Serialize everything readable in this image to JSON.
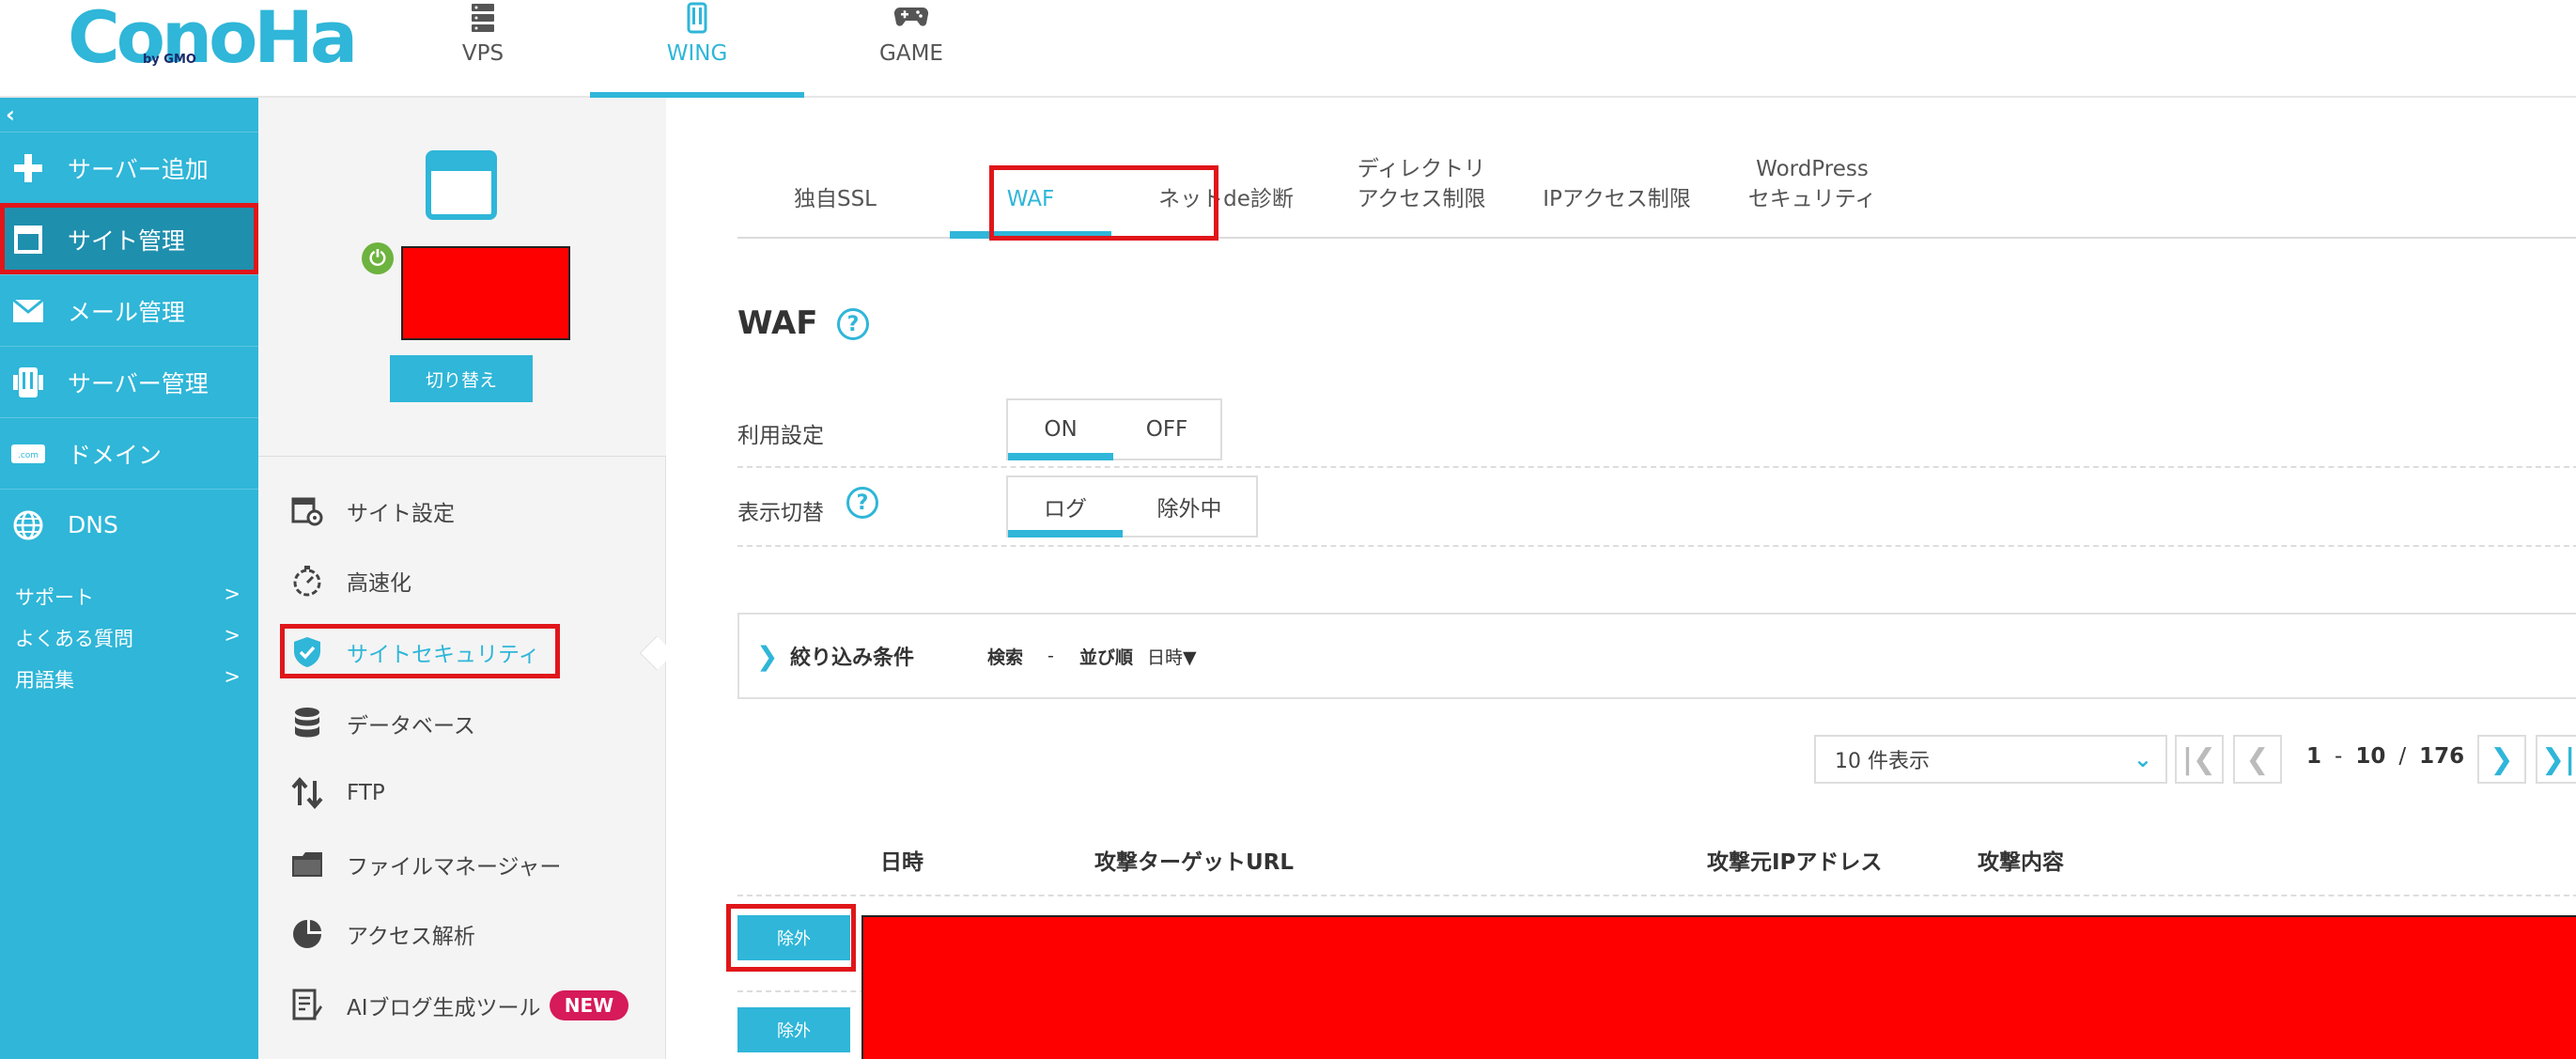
{
  "header": {
    "logo_text": "ConoHa",
    "logo_sub": "by GMO",
    "product_tabs": [
      {
        "label": "VPS",
        "icon": "server-icon",
        "active": false
      },
      {
        "label": "WING",
        "icon": "wing-icon",
        "active": true
      },
      {
        "label": "GAME",
        "icon": "gamepad-icon",
        "active": false
      }
    ]
  },
  "sidebar": {
    "collapse_label": "‹",
    "items": [
      {
        "label": "サーバー追加",
        "icon": "plus-icon",
        "active": false
      },
      {
        "label": "サイト管理",
        "icon": "window-icon",
        "active": true
      },
      {
        "label": "メール管理",
        "icon": "mail-icon",
        "active": false
      },
      {
        "label": "サーバー管理",
        "icon": "server-manage-icon",
        "active": false
      },
      {
        "label": "ドメイン",
        "icon": "domain-icon",
        "active": false
      },
      {
        "label": "DNS",
        "icon": "globe-icon",
        "active": false
      }
    ],
    "links": [
      {
        "label": "サポート",
        "arrow": ">"
      },
      {
        "label": "よくある質問",
        "arrow": ">"
      },
      {
        "label": "用語集",
        "arrow": ">"
      }
    ]
  },
  "site_panel": {
    "switch_label": "切り替え",
    "menu": [
      {
        "label": "サイト設定",
        "icon": "site-settings-icon",
        "active": false
      },
      {
        "label": "高速化",
        "icon": "stopwatch-icon",
        "active": false
      },
      {
        "label": "サイトセキュリティ",
        "icon": "shield-check-icon",
        "active": true
      },
      {
        "label": "データベース",
        "icon": "database-icon",
        "active": false
      },
      {
        "label": "FTP",
        "icon": "transfer-icon",
        "active": false
      },
      {
        "label": "ファイルマネージャー",
        "icon": "folder-icon",
        "active": false
      },
      {
        "label": "アクセス解析",
        "icon": "pie-chart-icon",
        "active": false
      },
      {
        "label": "AIブログ生成ツール",
        "icon": "document-edit-icon",
        "active": false,
        "badge": "NEW"
      }
    ]
  },
  "main": {
    "tabs": [
      {
        "label": "独自SSL",
        "active": false
      },
      {
        "label": "WAF",
        "active": true
      },
      {
        "label": "ネットde診断",
        "active": false
      },
      {
        "label": "ディレクトリ\nアクセス制限",
        "active": false
      },
      {
        "label": "IPアクセス制限",
        "active": false
      },
      {
        "label": "WordPress\nセキュリティ",
        "active": false
      }
    ],
    "title": "WAF",
    "help_glyph": "?",
    "usage": {
      "label": "利用設定",
      "options": [
        "ON",
        "OFF"
      ],
      "selected": "ON"
    },
    "display": {
      "label": "表示切替",
      "options": [
        "ログ",
        "除外中"
      ],
      "selected": "ログ"
    },
    "filter": {
      "chevron": "❯",
      "title": "絞り込み条件",
      "search_label": "検索",
      "search_value": "-",
      "sort_label": "並び順",
      "sort_value": "日時▼"
    },
    "pagination": {
      "per_page": "10 件表示",
      "first": "|❮",
      "prev": "❮",
      "next": "❯",
      "last": "❯|",
      "range_start": "1",
      "range_sep": "-",
      "range_end": "10",
      "total_sep": "/",
      "total": "176"
    },
    "table": {
      "headers": [
        "日時",
        "攻撃ターゲットURL",
        "攻撃元IPアドレス",
        "攻撃内容"
      ],
      "exclude_label": "除外"
    }
  },
  "colors": {
    "accent": "#2fb6d8",
    "highlight_box": "#e0161a",
    "redaction": "#ff0000",
    "new_badge": "#d61a5a",
    "power_on": "#6db33f"
  }
}
